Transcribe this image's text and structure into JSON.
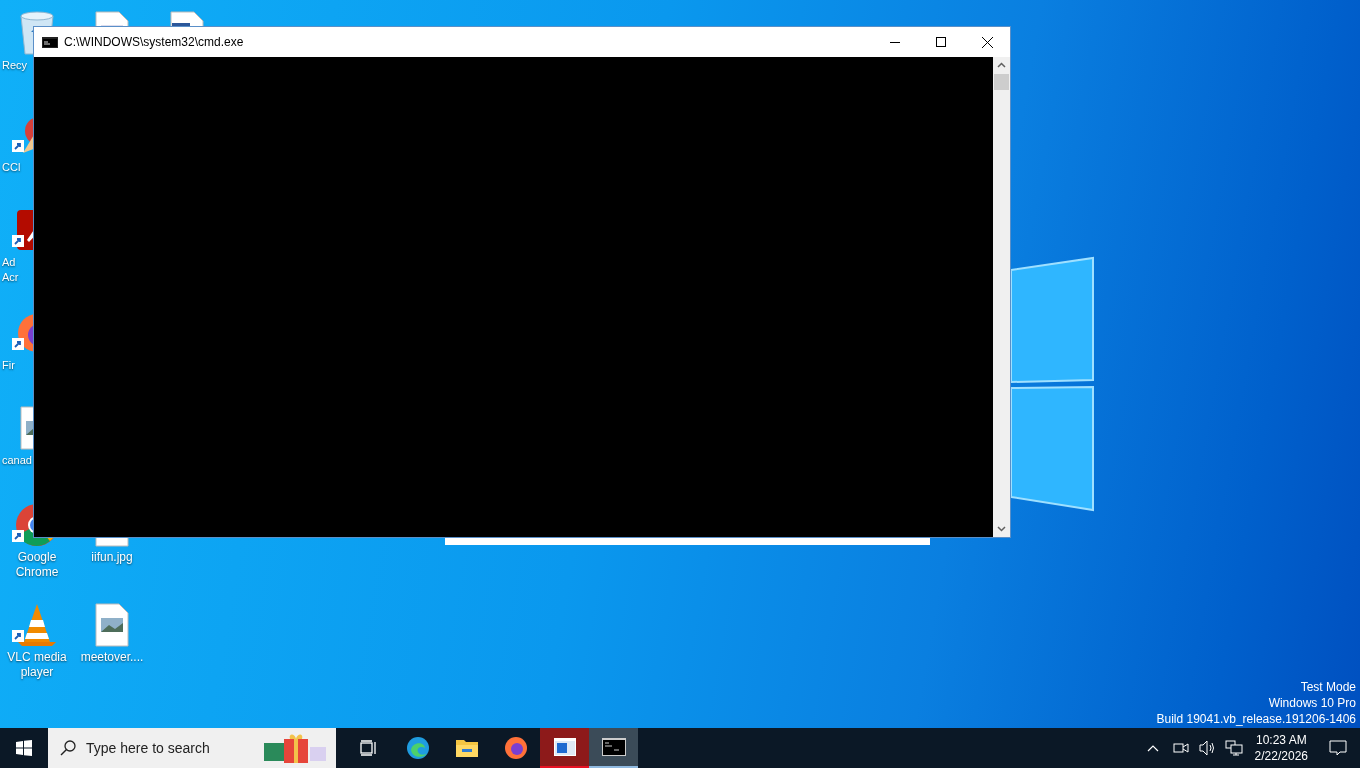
{
  "desktop_icons": [
    {
      "kind": "recycle",
      "label": "Recy"
    },
    {
      "kind": "document"
    },
    {
      "kind": "word"
    },
    {
      "kind": "cleaner",
      "label": "CCl",
      "shortcut": true
    },
    {
      "kind": "acrobat",
      "label": "Ad\nAcr",
      "shortcut": true
    },
    {
      "kind": "firefox",
      "label": "Fir",
      "shortcut": true
    },
    {
      "kind": "image",
      "label": "canad"
    },
    {
      "kind": "chrome",
      "label": "Google\nChrome",
      "shortcut": true
    },
    {
      "kind": "image",
      "label": "iifun.jpg"
    },
    {
      "kind": "vlc",
      "label": "VLC media\nplayer",
      "shortcut": true
    },
    {
      "kind": "image",
      "label": "meetover...."
    }
  ],
  "window": {
    "title": "C:\\WINDOWS\\system32\\cmd.exe"
  },
  "watermark": [
    "Test Mode",
    "Windows 10 Pro",
    "Build 19041.vb_release.191206-1406"
  ],
  "taskbar": {
    "search": {
      "placeholder": "Type here to search"
    },
    "apps": [
      {
        "kind": "taskview",
        "selected": false,
        "flashing": false
      },
      {
        "kind": "edge",
        "selected": false,
        "flashing": false
      },
      {
        "kind": "explorer",
        "selected": false,
        "flashing": false
      },
      {
        "kind": "firefox",
        "selected": false,
        "flashing": false
      },
      {
        "kind": "window",
        "selected": false,
        "flashing": true
      },
      {
        "kind": "console",
        "selected": true,
        "flashing": false
      }
    ],
    "time": "10:23 AM",
    "date": "2/22/2026"
  }
}
